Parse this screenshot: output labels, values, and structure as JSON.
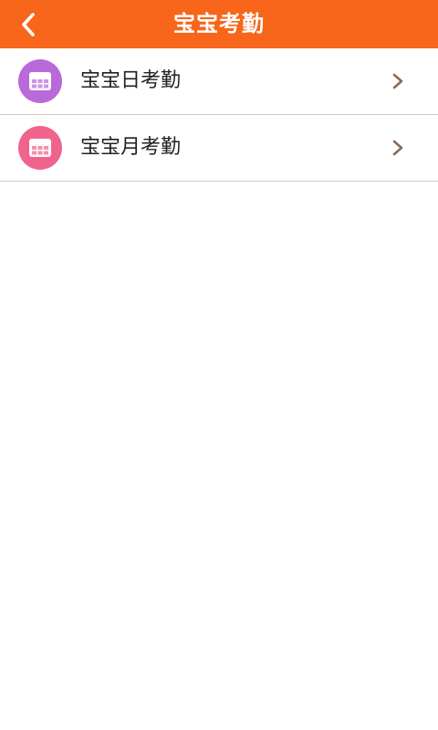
{
  "header": {
    "title": "宝宝考勤",
    "back_icon": "chevron-left-icon",
    "background_color": "#f7661a"
  },
  "menu": {
    "items": [
      {
        "label": "宝宝日考勤",
        "icon": "calendar-day-icon",
        "icon_color": "#b86ad9"
      },
      {
        "label": "宝宝月考勤",
        "icon": "calendar-month-icon",
        "icon_color": "#f0648c"
      }
    ],
    "chevron_icon": "chevron-right-icon",
    "chevron_color": "#8a6a55",
    "divider_color": "#d8c7b6"
  }
}
